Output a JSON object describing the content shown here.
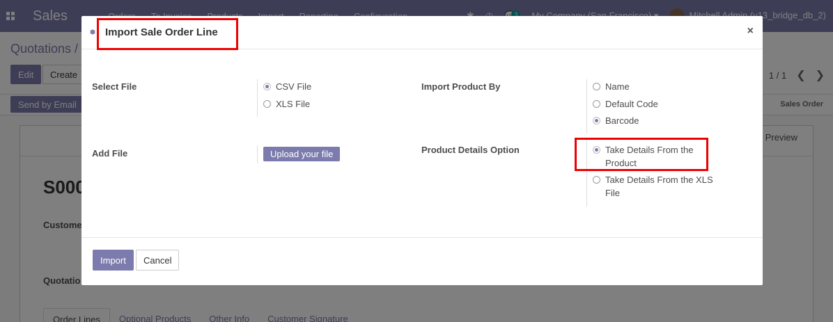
{
  "navbar": {
    "app_name": "Sales",
    "menu": [
      "Orders",
      "To Invoice",
      "Products",
      "Import",
      "Reporting",
      "Configuration"
    ],
    "messages_count": "3",
    "company": "My Company (San Francisco)",
    "user": "Mitchell Admin (v13_bridge_db_2)"
  },
  "control_panel": {
    "breadcrumb": "Quotations /",
    "edit_label": "Edit",
    "create_label": "Create",
    "pager": "1 / 1",
    "send_email_label": "Send by Email",
    "stage": "Sales Order"
  },
  "sheet": {
    "customer_preview": "Customer Preview",
    "doc_name": "S000",
    "customer_label": "Custome",
    "quotation_label": "Quotatio",
    "tabs": [
      "Order Lines",
      "Optional Products",
      "Other Info",
      "Customer Signature"
    ]
  },
  "modal": {
    "title": "Import Sale Order Line",
    "select_file_label": "Select File",
    "file_types": [
      {
        "label": "CSV File",
        "checked": true
      },
      {
        "label": "XLS File",
        "checked": false
      }
    ],
    "add_file_label": "Add File",
    "upload_label": "Upload your file",
    "import_by_label": "Import Product By",
    "import_by_options": [
      {
        "label": "Name",
        "checked": false
      },
      {
        "label": "Default Code",
        "checked": false
      },
      {
        "label": "Barcode",
        "checked": true
      }
    ],
    "details_label": "Product Details Option",
    "details_options": [
      {
        "label": "Take Details From the Product",
        "checked": true
      },
      {
        "label": "Take Details From the XLS File",
        "checked": false
      }
    ],
    "import_label": "Import",
    "cancel_label": "Cancel",
    "highlight_color": "#ee0000",
    "accent_color": "#7c7bad"
  }
}
